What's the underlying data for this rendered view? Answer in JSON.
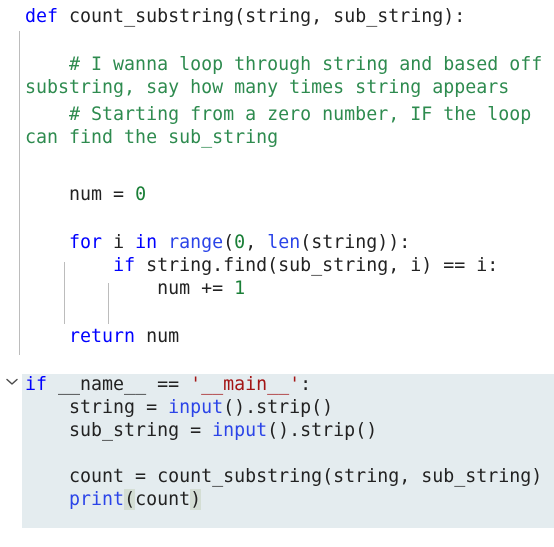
{
  "editor": {
    "language": "Python",
    "font_size_px": 18,
    "background_color": "#ffffff",
    "highlight_color": "#e4ecef",
    "indent_guide_color": "#b0b0b0",
    "bracket_match_color": "#d4ded4",
    "syntax_colors": {
      "keyword": "#0000ff",
      "builtin": "#2b44e8",
      "number": "#1a7f37",
      "comment": "#2e8b4f",
      "string": "#a31515",
      "plain": "#222222"
    },
    "fold_marker": "chevron-down"
  },
  "code": {
    "line_01": {
      "kw": "def",
      "rest": " count_substring(string, sub_string):"
    },
    "line_02_comment_a": "    # I wanna loop through string and based off",
    "line_02_comment_b": "substring, say how many times string appears",
    "line_03_comment_a": "    # Starting from a zero number, IF the loop",
    "line_03_comment_b": "can find the sub_string",
    "line_04": {
      "pre": "    num = ",
      "num": "0"
    },
    "line_05": {
      "kw1": "for",
      "mid1": " i ",
      "kw2": "in",
      "mid2": " ",
      "bn1": "range",
      "mid3": "(",
      "num1": "0",
      "mid4": ", ",
      "bn2": "len",
      "mid5": "(string)):",
      "indent": "    "
    },
    "line_06": {
      "indent": "        ",
      "kw": "if",
      "rest": " string.find(sub_string, i) == i:"
    },
    "line_07": {
      "pre": "            num += ",
      "num": "1"
    },
    "line_08": {
      "indent": "    ",
      "kw": "return",
      "rest": " num"
    },
    "line_09": {
      "kw": "if",
      "mid": " __name__ == ",
      "str": "'__main__'",
      "end": ":"
    },
    "line_10": {
      "pre": "    string = ",
      "bn": "input",
      "post": "().strip()"
    },
    "line_11": {
      "pre": "    sub_string = ",
      "bn": "input",
      "post": "().strip()"
    },
    "line_12": "    count = count_substring(string, sub_string)",
    "line_13": {
      "indent": "    ",
      "bn": "print",
      "open": "(",
      "arg": "count",
      "close": ")"
    }
  }
}
